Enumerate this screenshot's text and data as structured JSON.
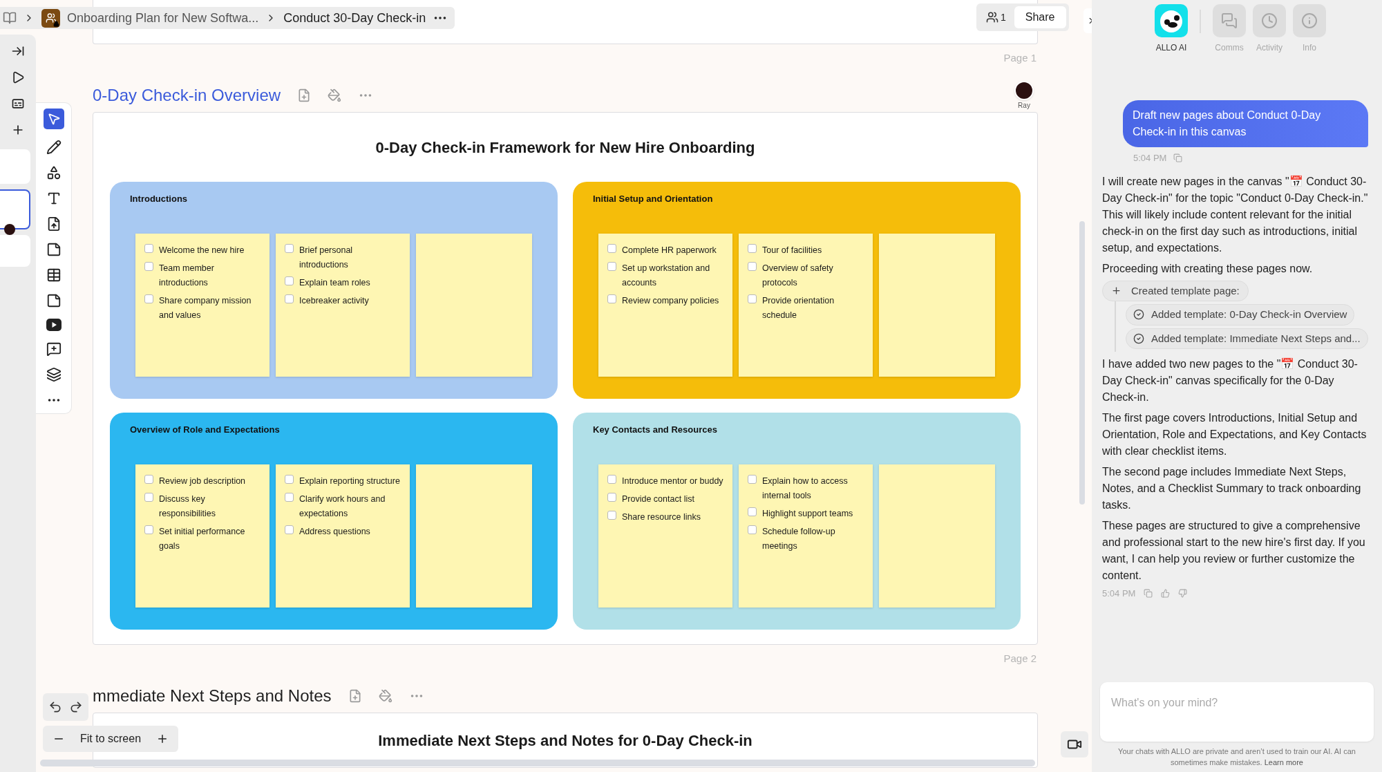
{
  "breadcrumb": {
    "items": [
      {
        "kind": "workspace",
        "label": "Onboarding Plan for New Softwa..."
      },
      {
        "kind": "current",
        "label": "Conduct 30-Day Check-in"
      }
    ]
  },
  "share": {
    "member_count": "1",
    "button": "Share"
  },
  "pages": [
    {
      "page_label": "Page 1",
      "title": "0-Day Check-in Overview",
      "selected": true,
      "collaborator": "Ray",
      "heading": "0-Day Check-in Framework for New Hire Onboarding",
      "boards": [
        {
          "title": "Introductions",
          "color": "#a8c9f2",
          "stickies": [
            {
              "kind": "checklist",
              "items": [
                {
                  "text": "Welcome the new hire",
                  "checked": false
                },
                {
                  "text": "Team member introductions",
                  "checked": false
                },
                {
                  "text": "Share company mission and values",
                  "checked": false
                }
              ]
            },
            {
              "kind": "checklist",
              "items": [
                {
                  "text": "Brief personal introductions",
                  "checked": false
                },
                {
                  "text": "Explain team roles",
                  "checked": false
                },
                {
                  "text": "Icebreaker activity",
                  "checked": false
                }
              ]
            },
            {
              "kind": "blank"
            }
          ]
        },
        {
          "title": "Initial Setup and Orientation",
          "color": "#f5bd0a",
          "stickies": [
            {
              "kind": "checklist",
              "items": [
                {
                  "text": "Complete HR paperwork",
                  "checked": false
                },
                {
                  "text": "Set up workstation and accounts",
                  "checked": false
                },
                {
                  "text": "Review company policies",
                  "checked": false
                }
              ]
            },
            {
              "kind": "checklist",
              "items": [
                {
                  "text": "Tour of facilities",
                  "checked": false
                },
                {
                  "text": "Overview of safety protocols",
                  "checked": false
                },
                {
                  "text": "Provide orientation schedule",
                  "checked": false
                }
              ]
            },
            {
              "kind": "blank"
            }
          ]
        },
        {
          "title": "Overview of Role and Expectations",
          "color": "#2bb7f0",
          "stickies": [
            {
              "kind": "checklist",
              "items": [
                {
                  "text": "Review job description",
                  "checked": false
                },
                {
                  "text": "Discuss key responsibilities",
                  "checked": false
                },
                {
                  "text": "Set initial performance goals",
                  "checked": false
                }
              ]
            },
            {
              "kind": "checklist",
              "items": [
                {
                  "text": "Explain reporting structure",
                  "checked": false
                },
                {
                  "text": "Clarify work hours and expectations",
                  "checked": false
                },
                {
                  "text": "Address questions",
                  "checked": false
                }
              ]
            },
            {
              "kind": "blank"
            }
          ]
        },
        {
          "title": "Key Contacts and Resources",
          "color": "#b1e0e8",
          "stickies": [
            {
              "kind": "checklist",
              "items": [
                {
                  "text": "Introduce mentor or buddy",
                  "checked": false
                },
                {
                  "text": "Provide contact list",
                  "checked": false
                },
                {
                  "text": "Share resource links",
                  "checked": false
                }
              ]
            },
            {
              "kind": "checklist",
              "items": [
                {
                  "text": "Explain how to access internal tools",
                  "checked": false
                },
                {
                  "text": "Highlight support teams",
                  "checked": false
                },
                {
                  "text": "Schedule follow-up meetings",
                  "checked": false
                }
              ]
            },
            {
              "kind": "blank"
            }
          ]
        }
      ]
    },
    {
      "page_label": "Page 2",
      "title": "mmediate Next Steps and Notes",
      "selected": false,
      "heading": "Immediate Next Steps and Notes for 0-Day Check-in"
    }
  ],
  "zoom": {
    "label": "Fit to screen"
  },
  "panel_tabs": [
    {
      "label": "ALLO AI",
      "selected": true
    },
    {
      "label": "Comms",
      "selected": false
    },
    {
      "label": "Activity",
      "selected": false
    },
    {
      "label": "Info",
      "selected": false
    }
  ],
  "chat": {
    "user_message": {
      "text": "Draft new pages about Conduct 0-Day Check-in in this canvas",
      "time": "5:04 PM"
    },
    "reply": {
      "intro": [
        "I will create new pages in the canvas \"📅 Conduct 30-Day Check-in\" for the topic \"Conduct 0-Day Check-in.\" This will likely include content relevant for the initial check-in on the first day such as introductions, initial setup, and expectations.",
        "Proceeding with creating these pages now."
      ],
      "action": {
        "label": "Created template page:",
        "steps": [
          {
            "label": "Added template: 0-Day Check-in Overview"
          },
          {
            "label": "Added template: Immediate Next Steps and..."
          }
        ]
      },
      "body": [
        "I have added two new pages to the \"📅 Conduct 30-Day Check-in\" canvas specifically for the 0-Day Check-in.",
        "The first page covers Introductions, Initial Setup and Orientation, Role and Expectations, and Key Contacts with clear checklist items.",
        "The second page includes Immediate Next Steps, Notes, and a Checklist Summary to track onboarding tasks.",
        "These pages are structured to give a comprehensive and professional start to the new hire's first day. If you want, I can help you review or further customize the content."
      ],
      "time": "5:04 PM"
    }
  },
  "composer": {
    "placeholder": "What's on your mind?"
  },
  "disclaimer": {
    "text": "Your chats with ALLO are private and aren’t used to train our AI. AI can sometimes make mistakes.",
    "link": "Learn more"
  }
}
